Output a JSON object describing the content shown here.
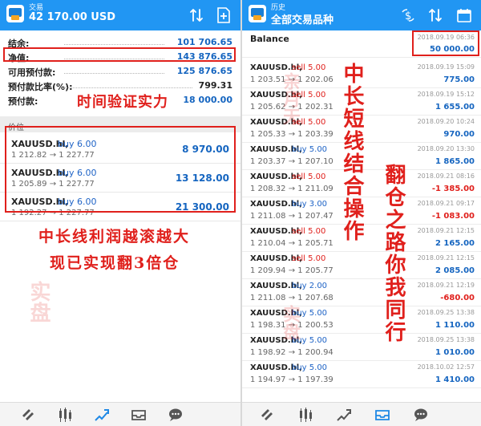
{
  "left": {
    "topbar": {
      "small": "交易",
      "big": "42 170.00 USD"
    },
    "summary": [
      {
        "label": "结余:",
        "value": "101 706.65"
      },
      {
        "label": "净值:",
        "value": "143 876.65"
      },
      {
        "label": "可用预付款:",
        "value": "125 876.65"
      },
      {
        "label": "预付款比率(%):",
        "value": "799.31"
      },
      {
        "label": "预付款:",
        "value": "18 000.00"
      }
    ],
    "overlay_time": "时间验证实力",
    "section_label": "价位",
    "positions": [
      {
        "symbol": "XAUUSD.hl,",
        "side": "buy 6.00",
        "prices": "1 212.82 → 1 227.77",
        "profit": "8 970.00"
      },
      {
        "symbol": "XAUUSD.hl,",
        "side": "buy 6.00",
        "prices": "1 205.89 → 1 227.77",
        "profit": "13 128.00"
      },
      {
        "symbol": "XAUUSD.hl,",
        "side": "buy 6.00",
        "prices": "1 192.27 → 1 227.77",
        "profit": "21 300.00"
      }
    ],
    "overlay_line1": "中长线利润越滚越大",
    "overlay_line2": "现已实现翻3倍仓",
    "watermark": "实盘"
  },
  "right": {
    "topbar": {
      "small": "历史",
      "big": "全部交易品种"
    },
    "balance": {
      "label": "Balance",
      "date": "2018.09.19 06:36",
      "amount": "50 000.00"
    },
    "history": [
      {
        "symbol": "XAUUSD.hl,",
        "side": "sell 5.00",
        "type": "sell",
        "prices": "1 203.51 → 1 202.06",
        "date": "2018.09.19 15:09",
        "amount": "775.00"
      },
      {
        "symbol": "XAUUSD.hl,",
        "side": "sell 5.00",
        "type": "sell",
        "prices": "1 205.62 → 1 202.31",
        "date": "2018.09.19 15:12",
        "amount": "1 655.00"
      },
      {
        "symbol": "XAUUSD.hl,",
        "side": "sell 5.00",
        "type": "sell",
        "prices": "1 205.33 → 1 203.39",
        "date": "2018.09.20 10:24",
        "amount": "970.00"
      },
      {
        "symbol": "XAUUSD.hl,",
        "side": "buy 5.00",
        "type": "buy",
        "prices": "1 203.37 → 1 207.10",
        "date": "2018.09.20 13:30",
        "amount": "1 865.00"
      },
      {
        "symbol": "XAUUSD.hl,",
        "side": "sell 5.00",
        "type": "sell",
        "prices": "1 208.32 → 1 211.09",
        "date": "2018.09.21 08:16",
        "amount": "-1 385.00"
      },
      {
        "symbol": "XAUUSD.hl,",
        "side": "buy 3.00",
        "type": "buy",
        "prices": "1 211.08 → 1 207.47",
        "date": "2018.09.21 09:17",
        "amount": "-1 083.00"
      },
      {
        "symbol": "XAUUSD.hl,",
        "side": "sell 5.00",
        "type": "sell",
        "prices": "1 210.04 → 1 205.71",
        "date": "2018.09.21 12:15",
        "amount": "2 165.00"
      },
      {
        "symbol": "XAUUSD.hl,",
        "side": "sell 5.00",
        "type": "sell",
        "prices": "1 209.94 → 1 205.77",
        "date": "2018.09.21 12:15",
        "amount": "2 085.00"
      },
      {
        "symbol": "XAUUSD.hl,",
        "side": "buy 2.00",
        "type": "buy",
        "prices": "1 211.08 → 1 207.68",
        "date": "2018.09.21 12:19",
        "amount": "-680.00"
      },
      {
        "symbol": "XAUUSD.hl,",
        "side": "buy 5.00",
        "type": "buy",
        "prices": "1 198.31 → 1 200.53",
        "date": "2018.09.25 13:38",
        "amount": "1 110.00"
      },
      {
        "symbol": "XAUUSD.hl,",
        "side": "buy 5.00",
        "type": "buy",
        "prices": "1 198.92 → 1 200.94",
        "date": "2018.09.25 13:38",
        "amount": "1 010.00"
      },
      {
        "symbol": "XAUUSD.hl,",
        "side": "buy 5.00",
        "type": "buy",
        "prices": "1 194.97 → 1 197.39",
        "date": "2018.10.02 12:57",
        "amount": "1 410.00"
      }
    ],
    "overlay_col1": "中长短线结合操作",
    "overlay_col2": "翻仓之路你我同行",
    "watermark1": "亲月天",
    "watermark2": "实盘"
  },
  "nav_icons": [
    "quotes-icon",
    "chart-icon",
    "trade-icon",
    "history-icon",
    "messages-icon"
  ],
  "colors": {
    "topbar": "#2196f3",
    "highlight": "#e0201c",
    "value_blue": "#1565c0",
    "buy_blue": "#1e63c6",
    "sell_red": "#e0201c"
  }
}
